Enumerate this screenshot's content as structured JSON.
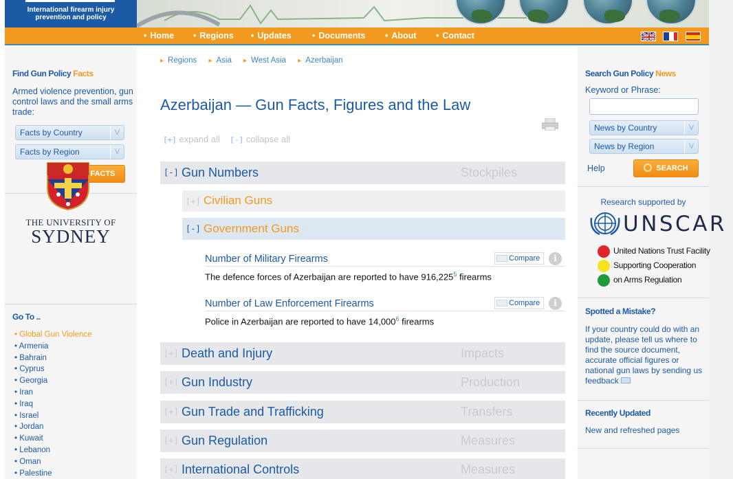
{
  "header": {
    "logo_line1": "International firearm injury",
    "logo_line2": "prevention and policy"
  },
  "nav": {
    "items": [
      "Home",
      "Regions",
      "Updates",
      "Documents",
      "About",
      "Contact"
    ],
    "flags": [
      "uk-flag",
      "france-flag",
      "spain-flag"
    ]
  },
  "left": {
    "find_head_1": "Find Gun Policy ",
    "find_head_2": "Facts",
    "find_desc": "Armed violence prevention, gun control laws and the small arms trade:",
    "select_country": "Facts by Country",
    "select_region": "Facts by Region",
    "find_button": "FIND FACTS",
    "university_small": "THE UNIVERSITY OF",
    "university_big": "SYDNEY",
    "goto_head": "Go To ..",
    "goto_items": [
      "Global Gun Violence",
      "Armenia",
      "Bahrain",
      "Cyprus",
      "Georgia",
      "Iran",
      "Iraq",
      "Israel",
      "Jordan",
      "Kuwait",
      "Lebanon",
      "Oman",
      "Palestine"
    ]
  },
  "main": {
    "breadcrumb": [
      "Regions",
      "Asia",
      "West Asia",
      "Azerbaijan"
    ],
    "title": "Azerbaijan — Gun Facts, Figures and the Law",
    "expand_all": "expand all",
    "collapse_all": "collapse all",
    "sections": [
      {
        "toggle": "[-]",
        "label": "Gun Numbers",
        "right": "Stockpiles"
      },
      {
        "toggle": "[+]",
        "label": "Death and Injury",
        "right": "Impacts"
      },
      {
        "toggle": "[+]",
        "label": "Gun Industry",
        "right": "Production"
      },
      {
        "toggle": "[+]",
        "label": "Gun Trade and Trafficking",
        "right": "Transfers"
      },
      {
        "toggle": "[+]",
        "label": "Gun Regulation",
        "right": "Measures"
      },
      {
        "toggle": "[+]",
        "label": "International Controls",
        "right": "Measures"
      }
    ],
    "subsections": [
      {
        "toggle": "[+]",
        "label": "Civilian Guns"
      },
      {
        "toggle": "[-]",
        "label": "Government Guns"
      }
    ],
    "facts": [
      {
        "title": "Number of Military Firearms",
        "text_pre": "The defence forces of Azerbaijan are reported to have 916,225",
        "ref": "5",
        "text_post": " firearms",
        "compare": "Compare"
      },
      {
        "title": "Number of Law Enforcement Firearms",
        "text_pre": "Police in Azerbaijan are reported to have 14,000",
        "ref": "6",
        "text_post": " firearms",
        "compare": "Compare"
      }
    ]
  },
  "right": {
    "search_head_1": "Search Gun Policy ",
    "search_head_2": "News",
    "keyword_label": "Keyword or Phrase:",
    "keyword_value": "",
    "select_country": "News by Country",
    "select_region": "News by Region",
    "help": "Help",
    "search_button": "SEARCH",
    "research_label": "Research supported by",
    "unscar": "UNSCAR",
    "unscar_lines": [
      "United Nations Trust Facility",
      "Supporting Cooperation",
      "on Arms Regulation"
    ],
    "mistake_head": "Spotted a Mistake?",
    "mistake_text": "If your country could do with an update, please tell us where to find the source document, accurate official figures or national gun laws by sending us feedback",
    "recent_head": "Recently Updated",
    "recent_text": "New and refreshed pages"
  },
  "colors": {
    "blue": "#1b5aa5",
    "orange": "#f29a1e",
    "red_dot": "#e0262b",
    "yellow_dot": "#f3e51d",
    "green_dot": "#1d9a3a"
  }
}
